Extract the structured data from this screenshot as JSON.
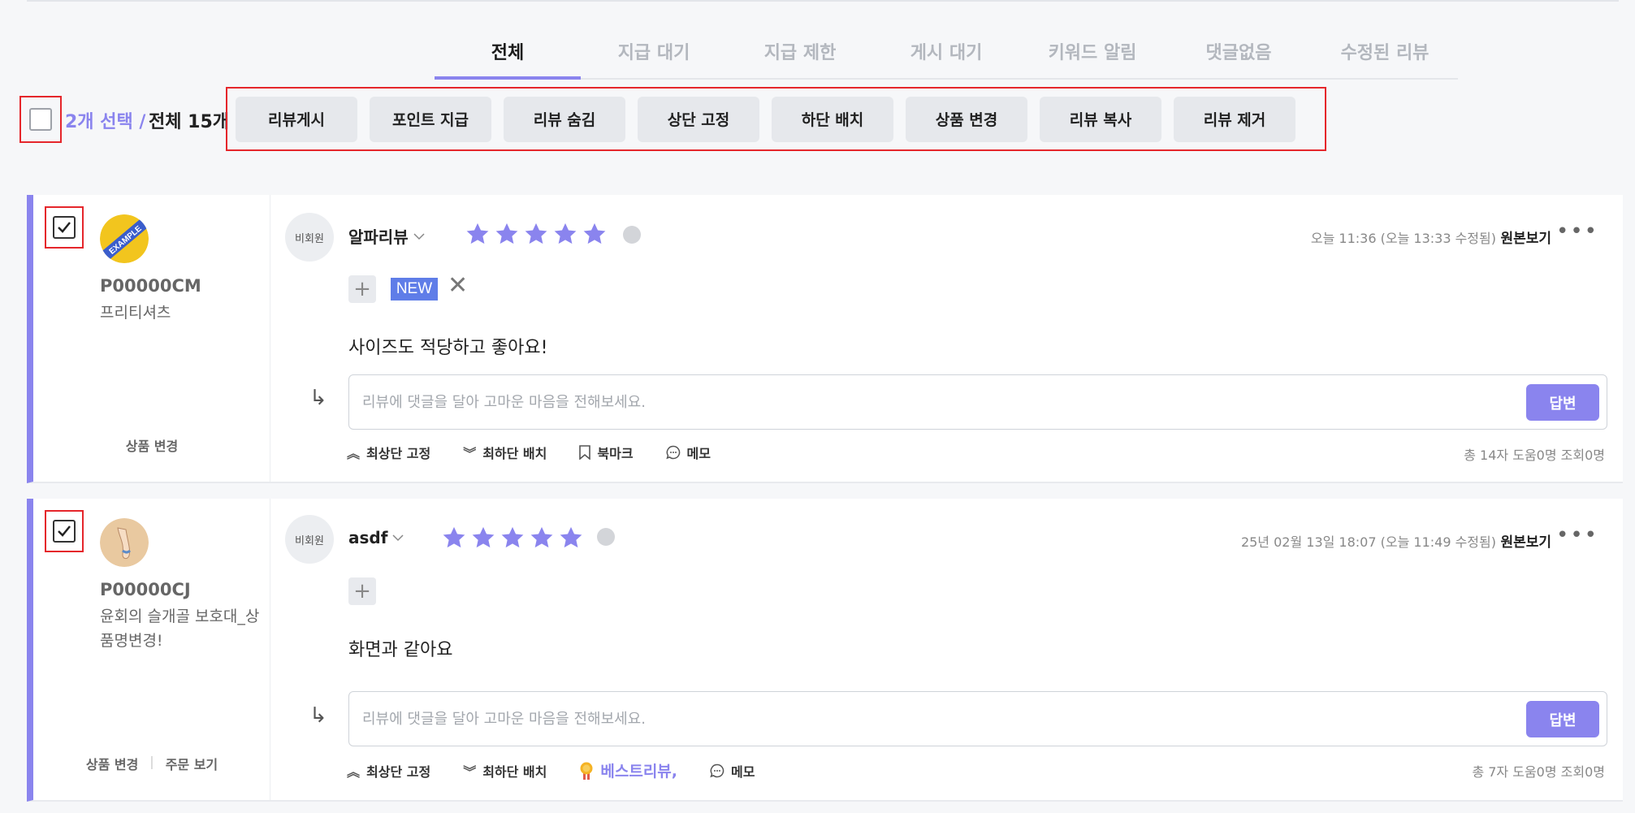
{
  "tabs": [
    {
      "label": "전체",
      "active": true
    },
    {
      "label": "지급 대기"
    },
    {
      "label": "지급 제한"
    },
    {
      "label": "게시 대기"
    },
    {
      "label": "키워드 알림"
    },
    {
      "label": "댓글없음"
    },
    {
      "label": "수정된 리뷰"
    }
  ],
  "selection": {
    "count_label": "2개 선택 /",
    "total_label": "전체 15개"
  },
  "actions": [
    "리뷰게시",
    "포인트 지급",
    "리뷰 숨김",
    "상단 고정",
    "하단 배치",
    "상품 변경",
    "리뷰 복사",
    "리뷰 제거"
  ],
  "colors": {
    "accent": "#8a84ee",
    "highlight": "#e5262b",
    "new_badge": "#5f7de8"
  },
  "reviews": [
    {
      "product_code": "P00000CM",
      "product_name": "프리티셔츠",
      "left_links": [
        "상품 변경"
      ],
      "member": "비회원",
      "author": "알파리뷰",
      "rating": 5,
      "date": "오늘 11:36 (오늘 13:33 수정됨)",
      "original_label": "원본보기",
      "badge": "NEW",
      "content": "사이즈도 적당하고 좋아요!",
      "reply_placeholder": "리뷰에 댓글을 달아 고마운 마음을 전해보세요.",
      "reply_button": "답변",
      "tools": {
        "pin_top": "최상단 고정",
        "pin_bottom": "최하단 배치",
        "bookmark": "북마크",
        "memo": "메모"
      },
      "stats": "총 14자 도움0명 조회0명"
    },
    {
      "product_code": "P00000CJ",
      "product_name": "윤회의 슬개골 보호대_상품명변경!",
      "left_links": [
        "상품 변경",
        "주문 보기"
      ],
      "member": "비회원",
      "author": "asdf",
      "rating": 5,
      "date": "25년 02월 13일 18:07 (오늘 11:49 수정됨)",
      "original_label": "원본보기",
      "content": "화면과 같아요",
      "reply_placeholder": "리뷰에 댓글을 달아 고마운 마음을 전해보세요.",
      "reply_button": "답변",
      "tools": {
        "pin_top": "최상단 고정",
        "pin_bottom": "최하단 배치",
        "best": "베스트리뷰,",
        "memo": "메모"
      },
      "stats": "총 7자 도움0명 조회0명"
    }
  ]
}
